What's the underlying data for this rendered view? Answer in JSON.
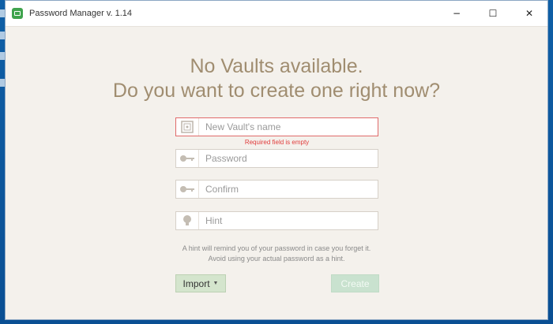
{
  "window": {
    "title": "Password Manager v. 1.14",
    "controls": {
      "minimize": "−",
      "maximize": "☐",
      "close": "✕"
    }
  },
  "heading": {
    "line1": "No Vaults available.",
    "line2": "Do you want to create one right now?"
  },
  "form": {
    "vault_name": {
      "placeholder": "New Vault's name",
      "value": "",
      "icon": "vault-icon"
    },
    "vault_error": "Required field is empty",
    "password": {
      "placeholder": "Password",
      "value": "",
      "icon": "key-icon"
    },
    "confirm": {
      "placeholder": "Confirm",
      "value": "",
      "icon": "key-icon"
    },
    "hint": {
      "placeholder": "Hint",
      "value": "",
      "icon": "lightbulb-icon"
    }
  },
  "hint_help": {
    "line1": "A hint will remind you of your password in case you forget it.",
    "line2": "Avoid using your actual password as a hint."
  },
  "buttons": {
    "import": "Import",
    "create": "Create"
  },
  "colors": {
    "heading": "#a08d70",
    "error": "#e03c3c",
    "import_bg": "#d4e5cd",
    "create_bg_disabled": "#c9e2cf"
  }
}
